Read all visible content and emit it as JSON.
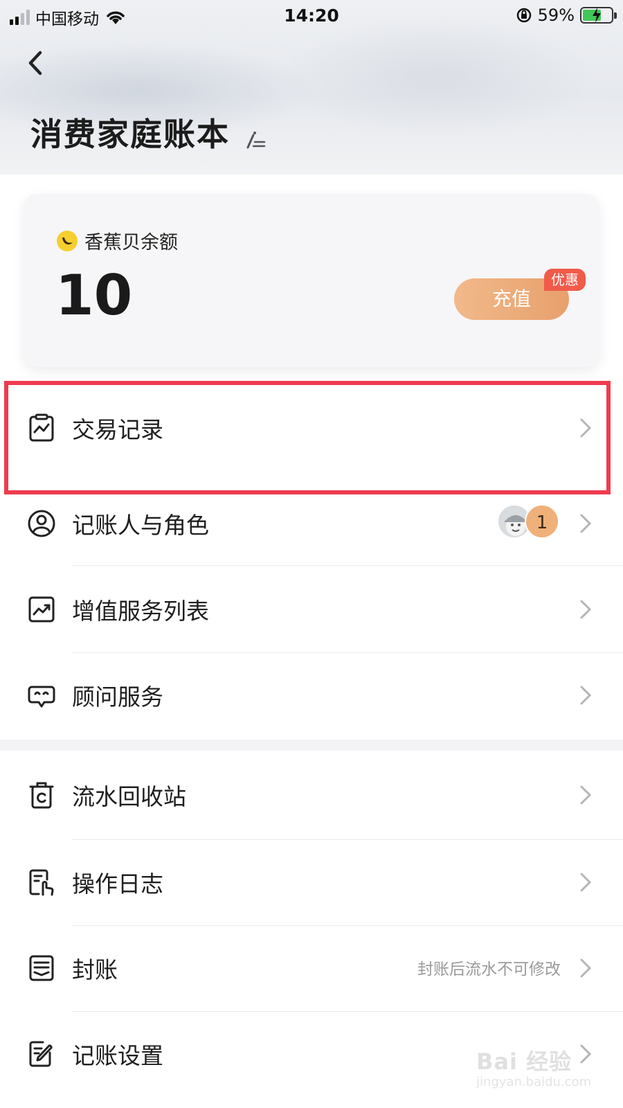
{
  "status_bar": {
    "carrier": "中国移动",
    "time": "14:20",
    "battery": "59%"
  },
  "header": {
    "title": "消费家庭账本"
  },
  "balance_card": {
    "label": "香蕉贝余额",
    "value": "10",
    "recharge_label": "充值",
    "promo_badge": "优惠"
  },
  "menu": {
    "transactions": "交易记录",
    "members": "记账人与角色",
    "members_count": "1",
    "value_added": "增值服务列表",
    "advisor": "顾问服务",
    "recycle_bin": "流水回收站",
    "operation_log": "操作日志",
    "close_books": "封账",
    "close_books_hint": "封账后流水不可修改",
    "settings": "记账设置"
  },
  "watermark": {
    "text": "Bai 经验",
    "url": "jingyan.baidu.com"
  }
}
